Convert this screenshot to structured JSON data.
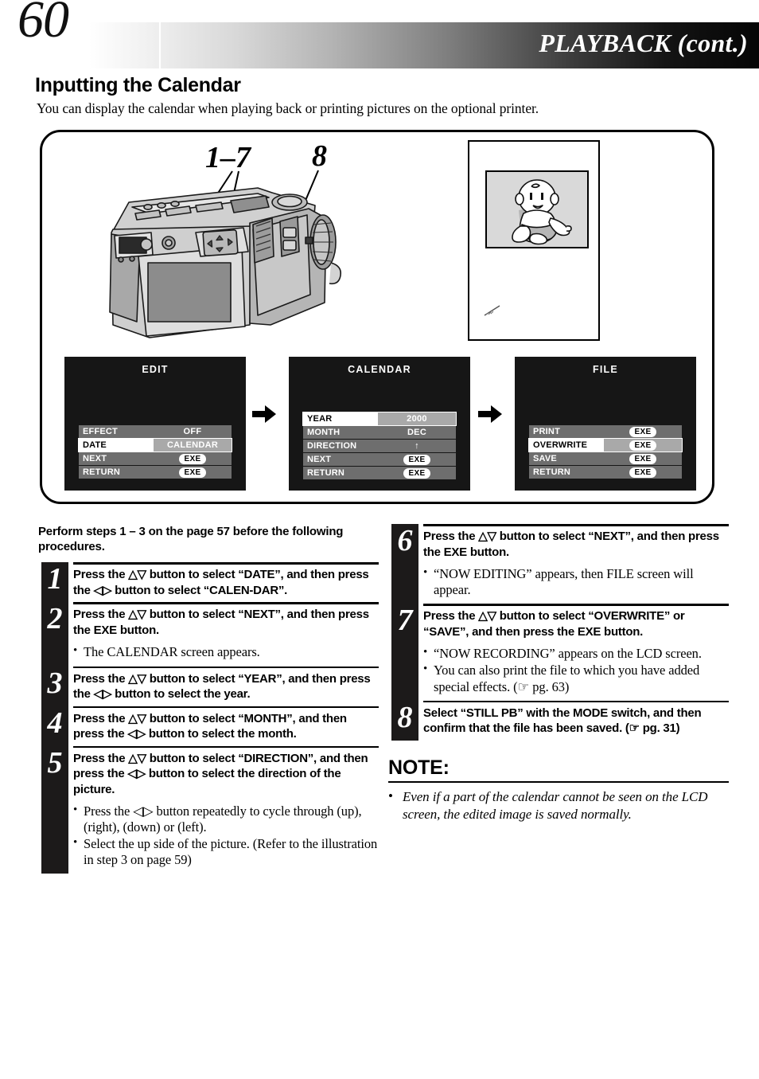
{
  "header": {
    "page_number": "60",
    "title": "PLAYBACK (cont.)"
  },
  "section": {
    "title": "Inputting the Calendar",
    "intro": "You can display the calendar when playing back or printing pictures on the optional printer."
  },
  "illustration": {
    "callout_steps_1_7": "1–7",
    "callout_step_8": "8",
    "camera_icon": "digital-camera-rear-view",
    "photo_icon": "baby-photo-illustration",
    "flow_arrow_icon": "right-arrow"
  },
  "osd_screens": [
    {
      "title": "EDIT",
      "rows": [
        {
          "label": "EFFECT",
          "value": "OFF",
          "type": "text",
          "selected": false
        },
        {
          "label": "DATE",
          "value": "CALENDAR",
          "type": "text",
          "selected": true
        },
        {
          "label": "NEXT",
          "value": "EXE",
          "type": "exe",
          "selected": false
        },
        {
          "label": "RETURN",
          "value": "EXE",
          "type": "exe",
          "selected": false
        }
      ]
    },
    {
      "title": "CALENDAR",
      "rows": [
        {
          "label": "YEAR",
          "value": "2000",
          "type": "text",
          "selected": true
        },
        {
          "label": "MONTH",
          "value": "DEC",
          "type": "text",
          "selected": false
        },
        {
          "label": "DIRECTION",
          "value": "↑",
          "type": "text",
          "selected": false
        },
        {
          "label": "NEXT",
          "value": "EXE",
          "type": "exe",
          "selected": false
        },
        {
          "label": "RETURN",
          "value": "EXE",
          "type": "exe",
          "selected": false
        }
      ]
    },
    {
      "title": "FILE",
      "rows": [
        {
          "label": "PRINT",
          "value": "EXE",
          "type": "exe",
          "selected": false
        },
        {
          "label": "OVERWRITE",
          "value": "EXE",
          "type": "exe",
          "selected": true
        },
        {
          "label": "SAVE",
          "value": "EXE",
          "type": "exe",
          "selected": false
        },
        {
          "label": "RETURN",
          "value": "EXE",
          "type": "exe",
          "selected": false
        }
      ]
    }
  ],
  "left_column": {
    "preamble": "Perform steps 1 – 3 on the page 57 before the following procedures.",
    "steps": [
      {
        "number": "1",
        "body": "Press the △▽ button to select “DATE”, and then press the ◁▷ button to select “CALEN-DAR”.",
        "bullets": []
      },
      {
        "number": "2",
        "body": "Press the △▽ button to select “NEXT”, and then press the EXE button.",
        "bullets": [
          "The CALENDAR screen appears."
        ]
      },
      {
        "number": "3",
        "body": "Press the △▽ button to select “YEAR”, and then press the ◁▷ button to select the year.",
        "bullets": []
      },
      {
        "number": "4",
        "body": "Press the △▽ button to select “MONTH”, and then press the ◁▷ button to select the month.",
        "bullets": []
      },
      {
        "number": "5",
        "body": "Press the △▽ button to select “DIRECTION”, and then press the ◁▷ button to select the direction of the picture.",
        "bullets": [
          "Press the ◁▷ button repeatedly to cycle through (up), (right), (down) or (left).",
          "Select the up side of the picture. (Refer to the illustration in step 3 on page 59)"
        ]
      }
    ]
  },
  "right_column": {
    "steps": [
      {
        "number": "6",
        "body": "Press the △▽ button to select “NEXT”, and then press the EXE button.",
        "bullets": [
          "“NOW EDITING” appears, then FILE screen will appear."
        ]
      },
      {
        "number": "7",
        "body": "Press the △▽ button to select “OVERWRITE” or “SAVE”, and then press the EXE button.",
        "bullets": [
          "“NOW RECORDING” appears on the LCD screen.",
          "You can also print the file to which you have added special effects. (☞ pg. 63)"
        ]
      },
      {
        "number": "8",
        "body": "Select “STILL PB” with the MODE switch, and then confirm that the file has been saved. (☞ pg. 31)",
        "bullets": []
      }
    ],
    "note": {
      "title": "NOTE:",
      "items": [
        "Even if a part of the calendar cannot be seen on the LCD screen, the edited image is saved normally."
      ]
    }
  },
  "colors": {
    "osd_background": "#161616",
    "osd_row": "#6e6e6e",
    "osd_selected_label": "#ffffff",
    "osd_selected_value": "#a9a9a9",
    "numbar": "#1c1a1a"
  }
}
